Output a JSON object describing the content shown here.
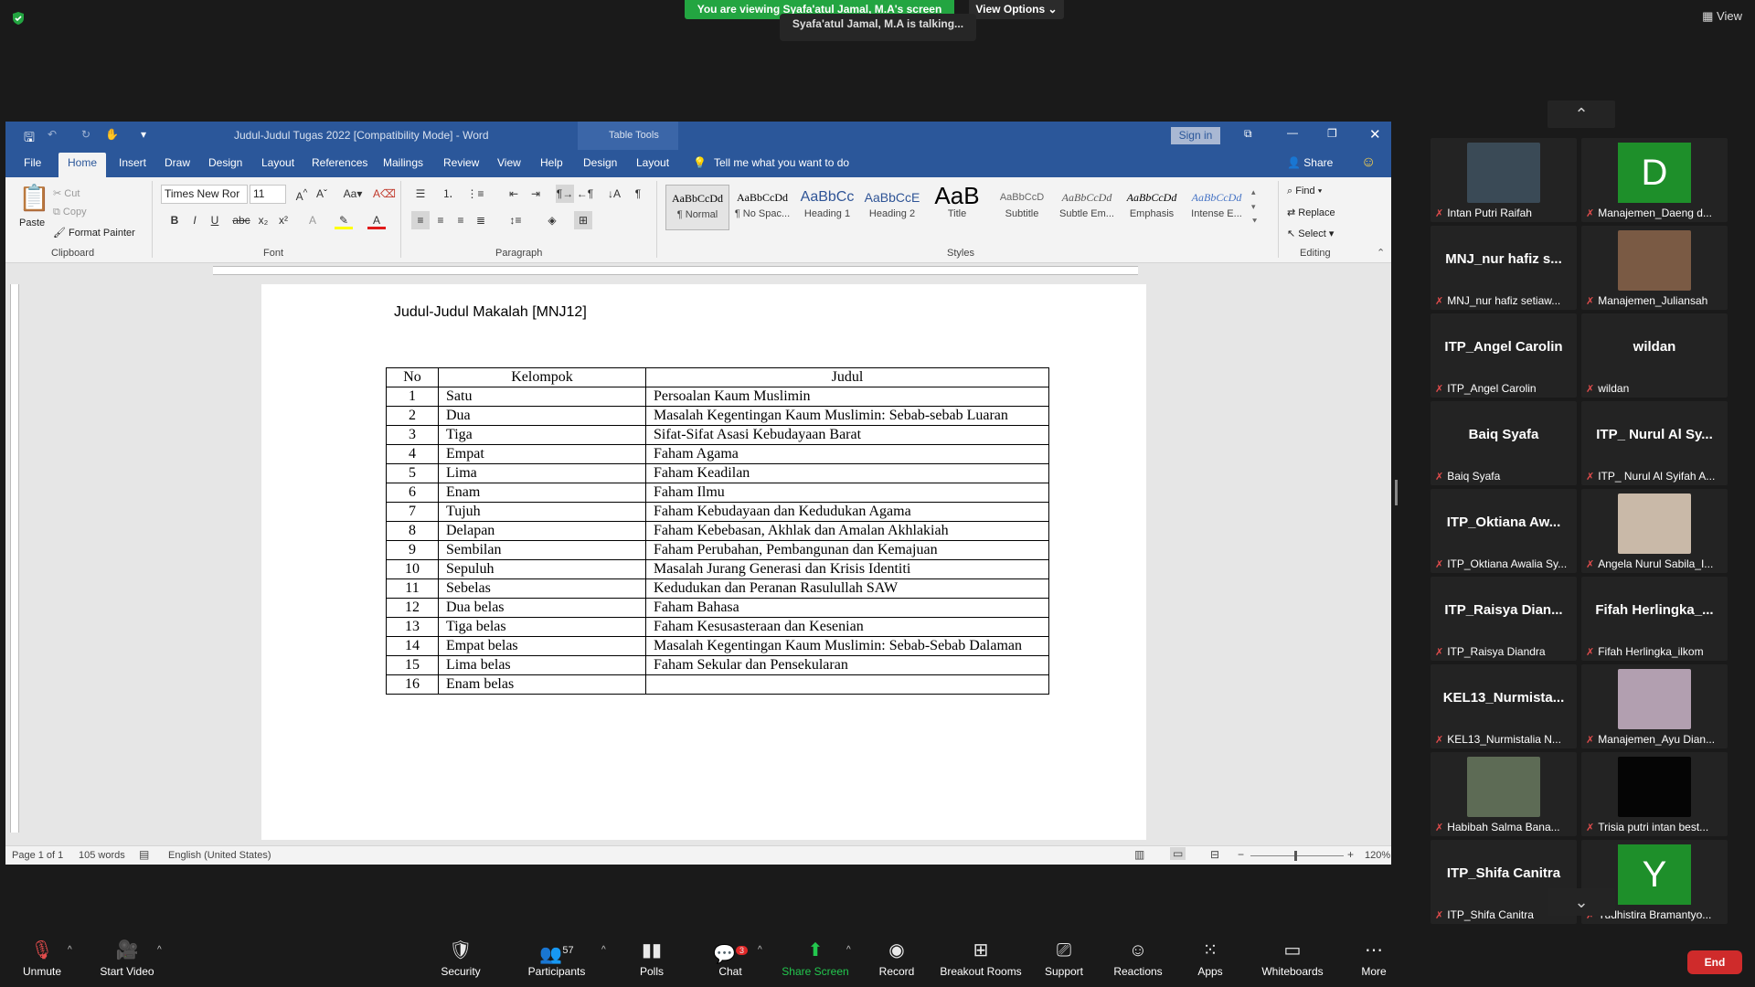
{
  "zoom": {
    "viewing_banner": "You are viewing Syafa'atul Jamal, M.A's screen",
    "view_options": "View Options",
    "talking": "Syafa'atul Jamal, M.A is talking...",
    "view_label": "View"
  },
  "word": {
    "title": "Judul-Judul Tugas 2022 [Compatibility Mode]  -  Word",
    "table_tools": "Table Tools",
    "sign_in": "Sign in",
    "tabs": [
      "File",
      "Home",
      "Insert",
      "Draw",
      "Design",
      "Layout",
      "References",
      "Mailings",
      "Review",
      "View",
      "Help",
      "Design",
      "Layout"
    ],
    "tell_me": "Tell me what you want to do",
    "share": "Share",
    "ribbon": {
      "paste": "Paste",
      "cut": "Cut",
      "copy": "Copy",
      "format_painter": "Format Painter",
      "clipboard": "Clipboard",
      "font_name": "Times New Ror",
      "font_size": "11",
      "font": "Font",
      "paragraph": "Paragraph",
      "styles_label": "Styles",
      "editing": "Editing",
      "find": "Find",
      "replace": "Replace",
      "select": "Select",
      "styles": [
        {
          "sample": "AaBbCcDd",
          "name": "¶ Normal"
        },
        {
          "sample": "AaBbCcDd",
          "name": "¶ No Spac..."
        },
        {
          "sample": "AaBbCc",
          "name": "Heading 1"
        },
        {
          "sample": "AaBbCcE",
          "name": "Heading 2"
        },
        {
          "sample": "AaB",
          "name": "Title"
        },
        {
          "sample": "AaBbCcD",
          "name": "Subtitle"
        },
        {
          "sample": "AaBbCcDd",
          "name": "Subtle Em..."
        },
        {
          "sample": "AaBbCcDd",
          "name": "Emphasis"
        },
        {
          "sample": "AaBbCcDd",
          "name": "Intense E..."
        }
      ]
    },
    "document": {
      "title": "Judul-Judul Makalah [MNJ12]",
      "headers": [
        "No",
        "Kelompok",
        "Judul"
      ],
      "rows": [
        [
          "1",
          "Satu",
          "Persoalan Kaum Muslimin"
        ],
        [
          "2",
          "Dua",
          "Masalah Kegentingan Kaum Muslimin: Sebab-sebab Luaran"
        ],
        [
          "3",
          "Tiga",
          "Sifat-Sifat Asasi Kebudayaan Barat"
        ],
        [
          "4",
          "Empat",
          "Faham Agama"
        ],
        [
          "5",
          "Lima",
          "Faham Keadilan"
        ],
        [
          "6",
          "Enam",
          "Faham Ilmu"
        ],
        [
          "7",
          "Tujuh",
          "Faham Kebudayaan dan Kedudukan Agama"
        ],
        [
          "8",
          "Delapan",
          "Faham Kebebasan, Akhlak dan Amalan Akhlakiah"
        ],
        [
          "9",
          "Sembilan",
          "Faham Perubahan, Pembangunan dan Kemajuan"
        ],
        [
          "10",
          "Sepuluh",
          "Masalah Jurang Generasi dan Krisis Identiti"
        ],
        [
          "11",
          "Sebelas",
          "Kedudukan dan Peranan Rasulullah SAW"
        ],
        [
          "12",
          "Dua belas",
          "Faham Bahasa"
        ],
        [
          "13",
          "Tiga belas",
          "Faham Kesusasteraan dan Kesenian"
        ],
        [
          "14",
          "Empat belas",
          "Masalah Kegentingan Kaum Muslimin: Sebab-Sebab Dalaman"
        ],
        [
          "15",
          "Lima belas",
          "Faham Sekular dan Pensekularan"
        ],
        [
          "16",
          "Enam belas",
          ""
        ]
      ]
    },
    "status": {
      "page": "Page 1 of 1",
      "words": "105 words",
      "language": "English (United States)",
      "zoom": "120%"
    }
  },
  "gallery": {
    "tiles": [
      {
        "name": "",
        "label": "Intan Putri Raifah",
        "kind": "video",
        "color": "#3a4a56"
      },
      {
        "name": "",
        "label": "Manajemen_Daeng d...",
        "kind": "letter",
        "letter": "D"
      },
      {
        "name": "MNJ_nur hafiz s...",
        "label": "MNJ_nur hafiz setiaw...",
        "kind": "name"
      },
      {
        "name": "",
        "label": "Manajemen_Juliansah",
        "kind": "video",
        "color": "#7a5a44"
      },
      {
        "name": "ITP_Angel Carolin",
        "label": "ITP_Angel Carolin",
        "kind": "name"
      },
      {
        "name": "wildan",
        "label": "wildan",
        "kind": "name"
      },
      {
        "name": "Baiq Syafa",
        "label": "Baiq Syafa",
        "kind": "name"
      },
      {
        "name": "ITP_ Nurul Al Sy...",
        "label": "ITP_ Nurul Al Syifah A...",
        "kind": "name"
      },
      {
        "name": "ITP_Oktiana  Aw...",
        "label": "ITP_Oktiana Awalia Sy...",
        "kind": "name"
      },
      {
        "name": "",
        "label": "Angela Nurul Sabila_I...",
        "kind": "video",
        "color": "#c9b9a8"
      },
      {
        "name": "ITP_Raisya  Dian...",
        "label": "ITP_Raisya Diandra",
        "kind": "name"
      },
      {
        "name": "Fifah  Herlingka_...",
        "label": "Fifah Herlingka_ilkom",
        "kind": "name"
      },
      {
        "name": "KEL13_Nurmista...",
        "label": "KEL13_Nurmistalia N...",
        "kind": "name"
      },
      {
        "name": "",
        "label": "Manajemen_Ayu Dian...",
        "kind": "video",
        "color": "#b29fb0"
      },
      {
        "name": "",
        "label": "Habibah Salma Bana...",
        "kind": "video",
        "color": "#5d6b55"
      },
      {
        "name": "",
        "label": "Trisia putri intan best...",
        "kind": "video",
        "color": "#050505"
      },
      {
        "name": "ITP_Shifa Canitra",
        "label": "ITP_Shifa Canitra",
        "kind": "name"
      },
      {
        "name": "",
        "label": "Yudhistira Bramantyo...",
        "kind": "letter",
        "letter": "Y"
      }
    ]
  },
  "toolbar": {
    "unmute": "Unmute",
    "start_video": "Start Video",
    "security": "Security",
    "participants": "Participants",
    "participants_count": "57",
    "polls": "Polls",
    "chat": "Chat",
    "chat_badge": "3",
    "share_screen": "Share Screen",
    "record": "Record",
    "breakout_rooms": "Breakout Rooms",
    "support": "Support",
    "reactions": "Reactions",
    "apps": "Apps",
    "whiteboards": "Whiteboards",
    "more": "More",
    "end": "End"
  },
  "colors": {
    "word_blue": "#2b579a",
    "zoom_green": "#23a541",
    "end_red": "#cf2b2b"
  }
}
